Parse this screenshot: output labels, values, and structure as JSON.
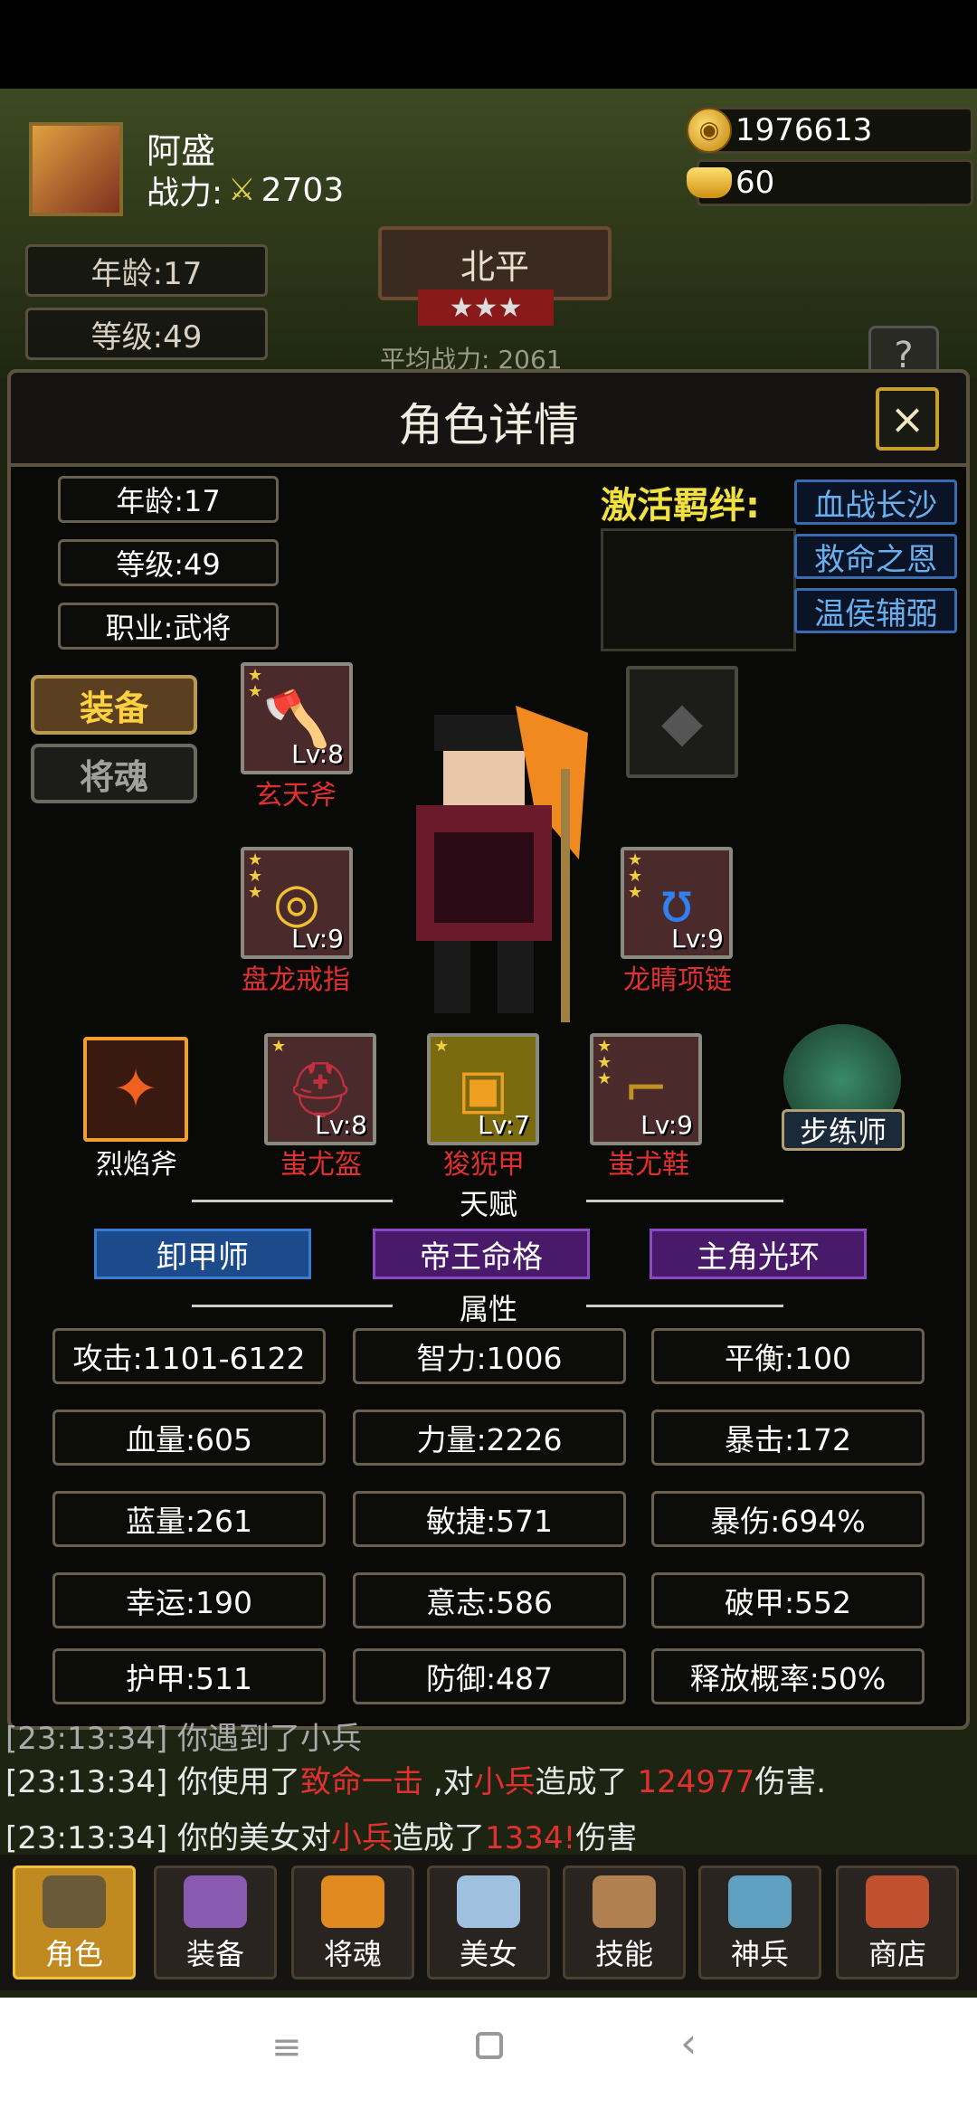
{
  "player": {
    "name": "阿盛",
    "power_label": "战力:",
    "power": "2703"
  },
  "currency": {
    "gold": "1976613",
    "ingot": "60"
  },
  "hud": {
    "age": "年龄:17",
    "level": "等级:49",
    "city": "北平",
    "city_stars": "★★★",
    "avg_power": "平均战力: 2061",
    "help": "?"
  },
  "dialog": {
    "title": "角色详情",
    "close": "×",
    "age": "年龄:17",
    "level": "等级:49",
    "job": "职业:武将",
    "bond_title": "激活羁绊:",
    "bonds": [
      "血战长沙",
      "救命之恩",
      "温侯辅弼"
    ],
    "tabs": {
      "equip": "装备",
      "soul": "将魂"
    }
  },
  "equipment": [
    {
      "name": "玄天斧",
      "level": "Lv:8",
      "icon": "axe-icon"
    },
    {
      "name": "盘龙戒指",
      "level": "Lv:9",
      "icon": "ring-icon"
    },
    {
      "name": "龙睛项链",
      "level": "Lv:9",
      "icon": "necklace-icon"
    },
    {
      "name": "蚩尤盔",
      "level": "Lv:8",
      "icon": "helmet-icon"
    },
    {
      "name": "狻猊甲",
      "level": "Lv:7",
      "icon": "armor-icon"
    },
    {
      "name": "蚩尤鞋",
      "level": "Lv:9",
      "icon": "boots-icon"
    }
  ],
  "weapon_skill": "烈焰斧",
  "companion": "步练师",
  "talent": {
    "title": "天赋",
    "items": [
      "卸甲师",
      "帝王命格",
      "主角光环"
    ]
  },
  "attributes": {
    "title": "属性",
    "rows": [
      [
        "攻击:1101-6122",
        "智力:1006",
        "平衡:100"
      ],
      [
        "血量:605",
        "力量:2226",
        "暴击:172"
      ],
      [
        "蓝量:261",
        "敏捷:571",
        "暴伤:694%"
      ],
      [
        "幸运:190",
        "意志:586",
        "破甲:552"
      ],
      [
        "护甲:511",
        "防御:487",
        "释放概率:50%"
      ]
    ]
  },
  "log": {
    "line0": "[23:13:34] 你遇到了小兵",
    "line1": {
      "time": "[23:13:34] ",
      "a": "你使用了",
      "skill": "致命一击",
      "b": " ,对",
      "target": "小兵",
      "c": "造成了 ",
      "dmg": "124977",
      "d": "伤害."
    },
    "line2": {
      "time": "[23:13:34] ",
      "a": "你的美女对",
      "target": "小兵",
      "c": "造成了",
      "dmg": "1334!",
      "d": "伤害"
    }
  },
  "nav": [
    "角色",
    "装备",
    "将魂",
    "美女",
    "技能",
    "神兵",
    "商店"
  ],
  "colors": {
    "accent_gold": "#ffd040",
    "damage_red": "#e03030",
    "bond_blue": "#6ab0f0",
    "talent_purple": "#6a2a9a"
  }
}
